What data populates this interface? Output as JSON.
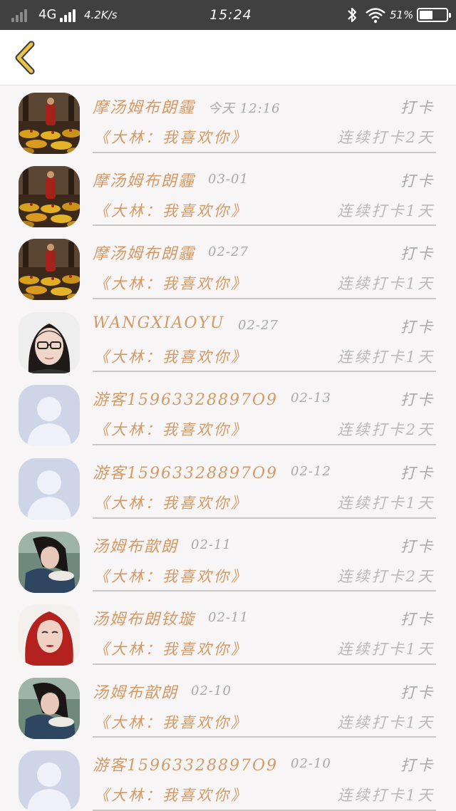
{
  "status_bar": {
    "network": "4G",
    "speed": "4.2K/s",
    "time": "15:24",
    "battery_text": "51%",
    "battery_level": 0.51,
    "icons": [
      "signal-icon",
      "bluetooth-icon",
      "wifi-icon",
      "battery-icon"
    ]
  },
  "header": {
    "back_icon": "chevron-left-icon",
    "accent_color": "#e8c44a"
  },
  "colors": {
    "name": "#d49a66",
    "meta": "#a8a8a8",
    "divider": "#c9c6c6"
  },
  "records": [
    {
      "name": "摩汤姆布朗霾",
      "date": "今天 12:16",
      "action": "打卡",
      "book": "《大林：我喜欢你》",
      "streak": "连续打卡2天",
      "avatar": "monk"
    },
    {
      "name": "摩汤姆布朗霾",
      "date": "03-01",
      "action": "打卡",
      "book": "《大林：我喜欢你》",
      "streak": "连续打卡1天",
      "avatar": "monk"
    },
    {
      "name": "摩汤姆布朗霾",
      "date": "02-27",
      "action": "打卡",
      "book": "《大林：我喜欢你》",
      "streak": "连续打卡1天",
      "avatar": "monk"
    },
    {
      "name": "WANGXIAOYU",
      "date": "02-27",
      "action": "打卡",
      "book": "《大林：我喜欢你》",
      "streak": "连续打卡1天",
      "avatar": "glasses-girl"
    },
    {
      "name": "游客15963328897O9",
      "date": "02-13",
      "action": "打卡",
      "book": "《大林：我喜欢你》",
      "streak": "连续打卡2天",
      "avatar": "default"
    },
    {
      "name": "游客15963328897O9",
      "date": "02-12",
      "action": "打卡",
      "book": "《大林：我喜欢你》",
      "streak": "连续打卡1天",
      "avatar": "default"
    },
    {
      "name": "汤姆布歆朗",
      "date": "02-11",
      "action": "打卡",
      "book": "《大林：我喜欢你》",
      "streak": "连续打卡2天",
      "avatar": "hair-girl"
    },
    {
      "name": "汤姆布朗钕璇",
      "date": "02-11",
      "action": "打卡",
      "book": "《大林：我喜欢你》",
      "streak": "连续打卡1天",
      "avatar": "red-hair"
    },
    {
      "name": "汤姆布歆朗",
      "date": "02-10",
      "action": "打卡",
      "book": "《大林：我喜欢你》",
      "streak": "连续打卡1天",
      "avatar": "hair-girl"
    },
    {
      "name": "游客15963328897O9",
      "date": "02-10",
      "action": "打卡",
      "book": "《大林：我喜欢你》",
      "streak": "连续打卡1天",
      "avatar": "default"
    }
  ]
}
